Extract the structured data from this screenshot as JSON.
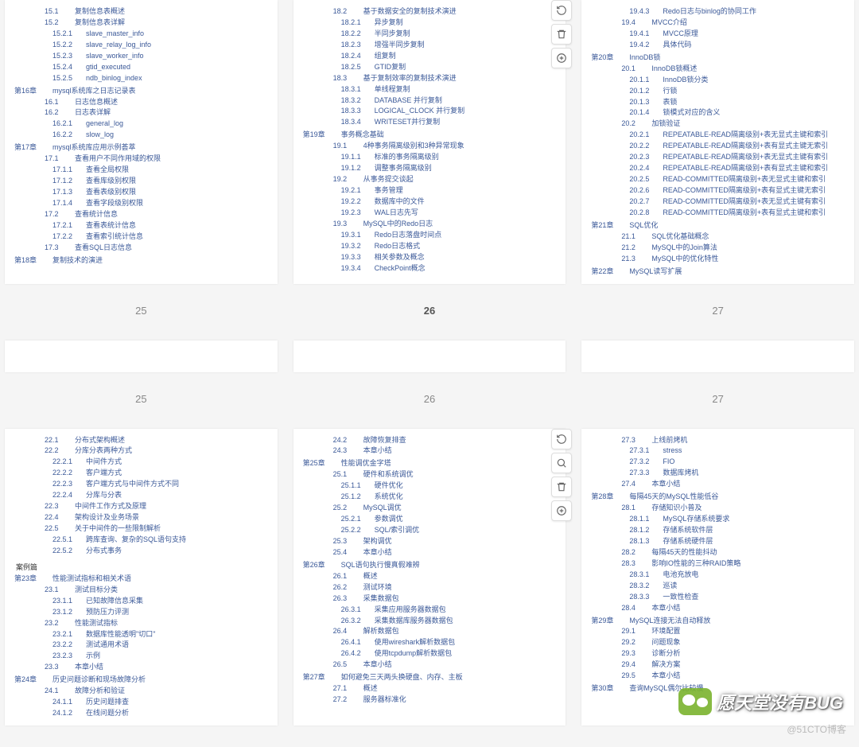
{
  "row1": {
    "p25": {
      "num": "25",
      "lines": [
        {
          "lv": 3,
          "n": "15.1",
          "t": "复制信息表概述"
        },
        {
          "lv": 3,
          "n": "15.2",
          "t": "复制信息表详解"
        },
        {
          "lv": 4,
          "n": "15.2.1",
          "t": "slave_master_info"
        },
        {
          "lv": 4,
          "n": "15.2.2",
          "t": "slave_relay_log_info"
        },
        {
          "lv": 4,
          "n": "15.2.3",
          "t": "slave_worker_info"
        },
        {
          "lv": 4,
          "n": "15.2.4",
          "t": "gtid_executed"
        },
        {
          "lv": 4,
          "n": "15.2.5",
          "t": "ndb_binlog_index"
        },
        {
          "lv": 1,
          "n": "第16章",
          "t": "mysql系统库之日志记录表"
        },
        {
          "lv": 3,
          "n": "16.1",
          "t": "日志信息概述"
        },
        {
          "lv": 3,
          "n": "16.2",
          "t": "日志表详解"
        },
        {
          "lv": 4,
          "n": "16.2.1",
          "t": "general_log"
        },
        {
          "lv": 4,
          "n": "16.2.2",
          "t": "slow_log"
        },
        {
          "lv": 1,
          "n": "第17章",
          "t": "mysql系统库应用示例荟萃"
        },
        {
          "lv": 3,
          "n": "17.1",
          "t": "查看用户不同作用域的权限"
        },
        {
          "lv": 4,
          "n": "17.1.1",
          "t": "查看全局权限"
        },
        {
          "lv": 4,
          "n": "17.1.2",
          "t": "查看库级别权限"
        },
        {
          "lv": 4,
          "n": "17.1.3",
          "t": "查看表级别权限"
        },
        {
          "lv": 4,
          "n": "17.1.4",
          "t": "查看字段级别权限"
        },
        {
          "lv": 3,
          "n": "17.2",
          "t": "查看统计信息"
        },
        {
          "lv": 4,
          "n": "17.2.1",
          "t": "查看表统计信息"
        },
        {
          "lv": 4,
          "n": "17.2.2",
          "t": "查看索引统计信息"
        },
        {
          "lv": 3,
          "n": "17.3",
          "t": "查看SQL日志信息"
        },
        {
          "lv": 1,
          "n": "第18章",
          "t": "复制技术的演进"
        }
      ]
    },
    "p26": {
      "num": "26",
      "tools": true,
      "lines": [
        {
          "lv": 3,
          "n": "18.2",
          "t": "基于数据安全的复制技术演进"
        },
        {
          "lv": 4,
          "n": "18.2.1",
          "t": "异步复制"
        },
        {
          "lv": 4,
          "n": "18.2.2",
          "t": "半同步复制"
        },
        {
          "lv": 4,
          "n": "18.2.3",
          "t": "增强半同步复制"
        },
        {
          "lv": 4,
          "n": "18.2.4",
          "t": "组复制"
        },
        {
          "lv": 4,
          "n": "18.2.5",
          "t": "GTID复制"
        },
        {
          "lv": 3,
          "n": "18.3",
          "t": "基于复制效率的复制技术演进"
        },
        {
          "lv": 4,
          "n": "18.3.1",
          "t": "单线程复制"
        },
        {
          "lv": 4,
          "n": "18.3.2",
          "t": "DATABASE 并行复制"
        },
        {
          "lv": 4,
          "n": "18.3.3",
          "t": "LOGICAL_CLOCK 并行复制"
        },
        {
          "lv": 4,
          "n": "18.3.4",
          "t": "WRITESET并行复制"
        },
        {
          "lv": 1,
          "n": "第19章",
          "t": "事务概念基础"
        },
        {
          "lv": 3,
          "n": "19.1",
          "t": "4种事务隔离级别和3种异常现象"
        },
        {
          "lv": 4,
          "n": "19.1.1",
          "t": "标准的事务隔离级别"
        },
        {
          "lv": 4,
          "n": "19.1.2",
          "t": "调整事务隔离级别"
        },
        {
          "lv": 3,
          "n": "19.2",
          "t": "从事务提交谈起"
        },
        {
          "lv": 4,
          "n": "19.2.1",
          "t": "事务管理"
        },
        {
          "lv": 4,
          "n": "19.2.2",
          "t": "数据库中的文件"
        },
        {
          "lv": 4,
          "n": "19.2.3",
          "t": "WAL日志先写"
        },
        {
          "lv": 3,
          "n": "19.3",
          "t": "MySQL中的Redo日志"
        },
        {
          "lv": 4,
          "n": "19.3.1",
          "t": "Redo日志落盘时间点"
        },
        {
          "lv": 4,
          "n": "19.3.2",
          "t": "Redo日志格式"
        },
        {
          "lv": 4,
          "n": "19.3.3",
          "t": "相关参数及概念"
        },
        {
          "lv": 4,
          "n": "19.3.4",
          "t": "CheckPoint概念"
        }
      ]
    },
    "p27": {
      "num": "27",
      "lines": [
        {
          "lv": 4,
          "n": "19.4.3",
          "t": "Redo日志与binlog的协同工作"
        },
        {
          "lv": 3,
          "n": "19.4",
          "t": "MVCC介绍"
        },
        {
          "lv": 4,
          "n": "19.4.1",
          "t": "MVCC原理"
        },
        {
          "lv": 4,
          "n": "19.4.2",
          "t": "具体代码"
        },
        {
          "lv": 1,
          "n": "第20章",
          "t": "InnoDB锁"
        },
        {
          "lv": 3,
          "n": "20.1",
          "t": "InnoDB锁概述"
        },
        {
          "lv": 4,
          "n": "20.1.1",
          "t": "InnoDB锁分类"
        },
        {
          "lv": 4,
          "n": "20.1.2",
          "t": "行锁"
        },
        {
          "lv": 4,
          "n": "20.1.3",
          "t": "表锁"
        },
        {
          "lv": 4,
          "n": "20.1.4",
          "t": "锁模式对应的含义"
        },
        {
          "lv": 3,
          "n": "20.2",
          "t": "加锁验证"
        },
        {
          "lv": 4,
          "n": "20.2.1",
          "t": "REPEATABLE-READ隔离级别+表无显式主键和索引"
        },
        {
          "lv": 4,
          "n": "20.2.2",
          "t": "REPEATABLE-READ隔离级别+表有显式主键无索引"
        },
        {
          "lv": 4,
          "n": "20.2.3",
          "t": "REPEATABLE-READ隔离级别+表无显式主键有索引"
        },
        {
          "lv": 4,
          "n": "20.2.4",
          "t": "REPEATABLE-READ隔离级别+表有显式主键和索引"
        },
        {
          "lv": 4,
          "n": "20.2.5",
          "t": "READ-COMMITTED隔离级别+表无显式主键和索引"
        },
        {
          "lv": 4,
          "n": "20.2.6",
          "t": "READ-COMMITTED隔离级别+表有显式主键无索引"
        },
        {
          "lv": 4,
          "n": "20.2.7",
          "t": "READ-COMMITTED隔离级别+表无显式主键有索引"
        },
        {
          "lv": 4,
          "n": "20.2.8",
          "t": "READ-COMMITTED隔离级别+表有显式主键和索引"
        },
        {
          "lv": 1,
          "n": "第21章",
          "t": "SQL优化"
        },
        {
          "lv": 3,
          "n": "21.1",
          "t": "SQL优化基础概念"
        },
        {
          "lv": 3,
          "n": "21.2",
          "t": "MySQL中的Join算法"
        },
        {
          "lv": 3,
          "n": "21.3",
          "t": "MySQL中的优化特性"
        },
        {
          "lv": 1,
          "n": "第22章",
          "t": "MySQL读写扩展"
        }
      ]
    }
  },
  "row2": {
    "p25": {
      "num": "25"
    },
    "p26": {
      "num": "26"
    },
    "p27": {
      "num": "27"
    }
  },
  "row3": {
    "p25": {
      "num": "",
      "lines": [
        {
          "lv": 3,
          "n": "22.1",
          "t": "分布式架构概述"
        },
        {
          "lv": 3,
          "n": "22.2",
          "t": "分库分表两种方式"
        },
        {
          "lv": 4,
          "n": "22.2.1",
          "t": "中间件方式"
        },
        {
          "lv": 4,
          "n": "22.2.2",
          "t": "客户端方式"
        },
        {
          "lv": 4,
          "n": "22.2.3",
          "t": "客户端方式与中间件方式不同"
        },
        {
          "lv": 4,
          "n": "22.2.4",
          "t": "分库与分表"
        },
        {
          "lv": 3,
          "n": "22.3",
          "t": "中间件工作方式及原理"
        },
        {
          "lv": 3,
          "n": "22.4",
          "t": "架构设计及业务场景"
        },
        {
          "lv": 3,
          "n": "22.5",
          "t": "关于中间件的一些限制解析"
        },
        {
          "lv": 4,
          "n": "22.5.1",
          "t": "跨库查询、复杂的SQL语句支持"
        },
        {
          "lv": 4,
          "n": "22.5.2",
          "t": "分布式事务"
        },
        {
          "lv": 0,
          "n": "案例篇",
          "t": ""
        },
        {
          "lv": 1,
          "n": "第23章",
          "t": "性能测试指标和相关术语"
        },
        {
          "lv": 3,
          "n": "23.1",
          "t": "测试目标分类"
        },
        {
          "lv": 4,
          "n": "23.1.1",
          "t": "已知故障信息采集"
        },
        {
          "lv": 4,
          "n": "23.1.2",
          "t": "预防压力评测"
        },
        {
          "lv": 3,
          "n": "23.2",
          "t": "性能测试指标"
        },
        {
          "lv": 4,
          "n": "23.2.1",
          "t": "数据库性能透明\"切口\""
        },
        {
          "lv": 4,
          "n": "23.2.2",
          "t": "测试通用术语"
        },
        {
          "lv": 4,
          "n": "23.2.3",
          "t": "示例"
        },
        {
          "lv": 3,
          "n": "23.3",
          "t": "本章小结"
        },
        {
          "lv": 1,
          "n": "第24章",
          "t": "历史问题诊断和现场故障分析"
        },
        {
          "lv": 3,
          "n": "24.1",
          "t": "故障分析和验证"
        },
        {
          "lv": 4,
          "n": "24.1.1",
          "t": "历史问题排查"
        },
        {
          "lv": 4,
          "n": "24.1.2",
          "t": "在线问题分析"
        }
      ]
    },
    "p26": {
      "num": "",
      "tools": true,
      "lines": [
        {
          "lv": 3,
          "n": "24.2",
          "t": "故障恢复排查"
        },
        {
          "lv": 3,
          "n": "24.3",
          "t": "本章小结"
        },
        {
          "lv": 1,
          "n": "第25章",
          "t": "性能调优金字塔"
        },
        {
          "lv": 3,
          "n": "25.1",
          "t": "硬件和系统调优"
        },
        {
          "lv": 4,
          "n": "25.1.1",
          "t": "硬件优化"
        },
        {
          "lv": 4,
          "n": "25.1.2",
          "t": "系统优化"
        },
        {
          "lv": 3,
          "n": "25.2",
          "t": "MySQL调优"
        },
        {
          "lv": 4,
          "n": "25.2.1",
          "t": "参数调优"
        },
        {
          "lv": 4,
          "n": "25.2.2",
          "t": "SQL/索引调优"
        },
        {
          "lv": 3,
          "n": "25.3",
          "t": "架构调优"
        },
        {
          "lv": 3,
          "n": "25.4",
          "t": "本章小结"
        },
        {
          "lv": 1,
          "n": "第26章",
          "t": "SQL语句执行慢真假难辨"
        },
        {
          "lv": 3,
          "n": "26.1",
          "t": "概述"
        },
        {
          "lv": 3,
          "n": "26.2",
          "t": "测试环境"
        },
        {
          "lv": 3,
          "n": "26.3",
          "t": "采集数据包"
        },
        {
          "lv": 4,
          "n": "26.3.1",
          "t": "采集应用服务器数据包"
        },
        {
          "lv": 4,
          "n": "26.3.2",
          "t": "采集数据库服务器数据包"
        },
        {
          "lv": 3,
          "n": "26.4",
          "t": "解析数据包"
        },
        {
          "lv": 4,
          "n": "26.4.1",
          "t": "使用wireshark解析数据包"
        },
        {
          "lv": 4,
          "n": "26.4.2",
          "t": "使用tcpdump解析数据包"
        },
        {
          "lv": 3,
          "n": "26.5",
          "t": "本章小结"
        },
        {
          "lv": 1,
          "n": "第27章",
          "t": "如何避免三天两头换硬盘、内存、主板"
        },
        {
          "lv": 3,
          "n": "27.1",
          "t": "概述"
        },
        {
          "lv": 3,
          "n": "27.2",
          "t": "服务器标准化"
        }
      ]
    },
    "p27": {
      "num": "",
      "lines": [
        {
          "lv": 3,
          "n": "27.3",
          "t": "上线前烤机"
        },
        {
          "lv": 4,
          "n": "27.3.1",
          "t": "stress"
        },
        {
          "lv": 4,
          "n": "27.3.2",
          "t": "FIO"
        },
        {
          "lv": 4,
          "n": "27.3.3",
          "t": "数据库烤机"
        },
        {
          "lv": 3,
          "n": "27.4",
          "t": "本章小结"
        },
        {
          "lv": 1,
          "n": "第28章",
          "t": "每隔45天的MySQL性能低谷"
        },
        {
          "lv": 3,
          "n": "28.1",
          "t": "存储知识小普及"
        },
        {
          "lv": 4,
          "n": "28.1.1",
          "t": "MySQL存储系统要求"
        },
        {
          "lv": 4,
          "n": "28.1.2",
          "t": "存储系统软件层"
        },
        {
          "lv": 4,
          "n": "28.1.3",
          "t": "存储系统硬件层"
        },
        {
          "lv": 3,
          "n": "28.2",
          "t": "每隔45天的性能抖动"
        },
        {
          "lv": 3,
          "n": "28.3",
          "t": "影响IO性能的三种RAID策略"
        },
        {
          "lv": 4,
          "n": "28.3.1",
          "t": "电池充放电"
        },
        {
          "lv": 4,
          "n": "28.3.2",
          "t": "巡读"
        },
        {
          "lv": 4,
          "n": "28.3.3",
          "t": "一致性检查"
        },
        {
          "lv": 3,
          "n": "28.4",
          "t": "本章小结"
        },
        {
          "lv": 1,
          "n": "第29章",
          "t": "MySQL连接无法自动释放"
        },
        {
          "lv": 3,
          "n": "29.1",
          "t": "环境配置"
        },
        {
          "lv": 3,
          "n": "29.2",
          "t": "问题现象"
        },
        {
          "lv": 3,
          "n": "29.3",
          "t": "诊断分析"
        },
        {
          "lv": 3,
          "n": "29.4",
          "t": "解决方案"
        },
        {
          "lv": 3,
          "n": "29.5",
          "t": "本章小结"
        },
        {
          "lv": 1,
          "n": "第30章",
          "t": "查询MySQL偶尔比较慢"
        }
      ]
    }
  },
  "watermark": "愿天堂没有BUG",
  "attribution": "@51CTO博客",
  "icons": {
    "refresh": "refresh-icon",
    "search": "search-icon",
    "trash": "trash-icon",
    "plus": "plus-icon"
  }
}
